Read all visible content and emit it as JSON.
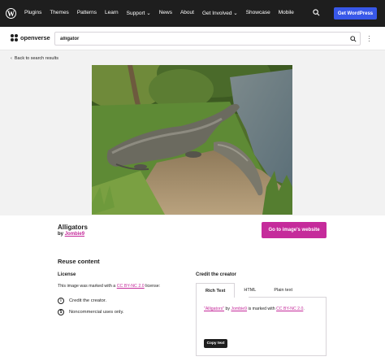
{
  "wpbar": {
    "nav": [
      "Plugins",
      "Themes",
      "Patterns",
      "Learn",
      "Support ⌄",
      "News",
      "About",
      "Get Involved ⌄",
      "Showcase",
      "Mobile"
    ],
    "get_wordpress": "Get WordPress",
    "background": "#1e1e1e",
    "button_color": "#3858e9"
  },
  "header": {
    "logo_text": "openverse",
    "search_value": "alligator"
  },
  "back_link": "Back to search results",
  "image": {
    "title": "Alligators",
    "by_prefix": "by",
    "author": "Jombie9",
    "goto_label": "Go to image's website",
    "accent": "#c52b9b"
  },
  "reuse": {
    "heading": "Reuse content",
    "license_heading": "License",
    "license_prefix": "This image was marked with a",
    "license_name": "CC BY-NC 2.0",
    "license_suffix": "license:",
    "terms": [
      {
        "icon": "person-icon",
        "text": "Credit the creator."
      },
      {
        "icon": "noncommercial-icon",
        "text": "Noncommercial uses only."
      }
    ]
  },
  "credit": {
    "heading": "Credit the creator",
    "tabs": [
      "Rich Text",
      "HTML",
      "Plain text"
    ],
    "active_tab": "Rich Text",
    "title_link": "\"Alligators\"",
    "by": "by",
    "author": "Jombie9",
    "marked": "is marked with",
    "license": "CC BY-NC 2.0",
    "end": ".",
    "copy_label": "Copy text"
  }
}
